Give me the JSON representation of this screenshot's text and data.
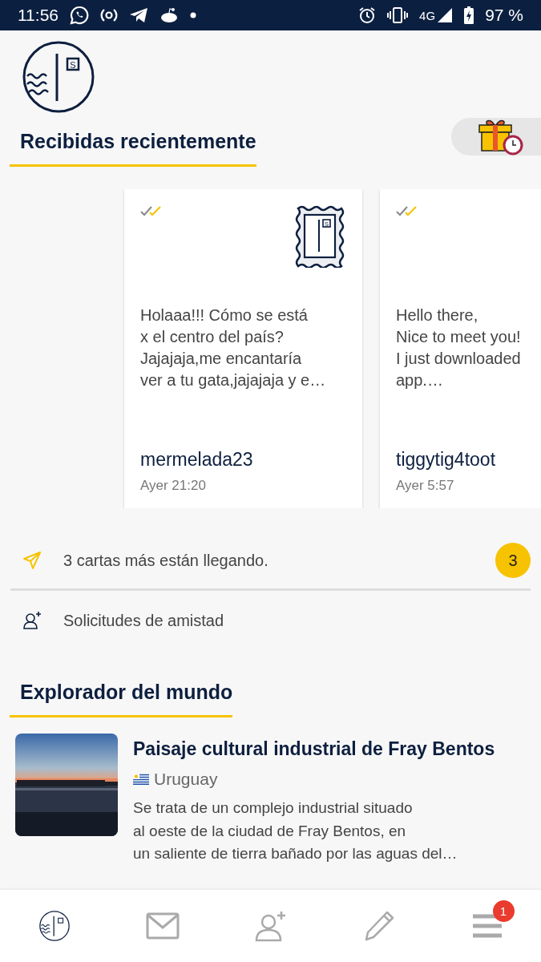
{
  "status_bar": {
    "time": "11:56",
    "network": "4G",
    "battery": "97 %"
  },
  "header": {
    "logo_mark": "S"
  },
  "recent": {
    "title": "Recibidas recientemente",
    "letters": [
      {
        "message": "Holaaa!!! Cómo se está\nx el centro del país?\nJajajaja,me encantaría\nver a tu gata,jajajaja y e…",
        "sender": "mermelada23",
        "time": "Ayer 21:20",
        "stamp": true,
        "stamp_mark": "S"
      },
      {
        "message": "Hello there,\nNice to meet you!\nI just downloaded\napp.…",
        "sender": "tiggytig4toot",
        "time": "Ayer 5:57"
      }
    ]
  },
  "arriving": {
    "text": "3 cartas más están llegando.",
    "count": "3"
  },
  "friend_requests": {
    "text": "Solicitudes de amistad"
  },
  "explorer": {
    "title": "Explorador del mundo",
    "article": {
      "kind": "picture",
      "title": "Paisaje cultural industrial de Fray Bentos",
      "country": "Uruguay",
      "description": "Se trata de un complejo industrial situado\nal oeste de la ciudad de Fray Bentos, en\nun saliente de tierra bañado por las aguas del…"
    }
  },
  "nav": {
    "items": [
      {
        "kind": "home",
        "selected": true
      },
      {
        "kind": "mail",
        "selected": false
      },
      {
        "kind": "friends",
        "selected": false
      },
      {
        "kind": "write",
        "selected": false
      },
      {
        "kind": "menu",
        "selected": false,
        "badge": "1"
      }
    ]
  }
}
